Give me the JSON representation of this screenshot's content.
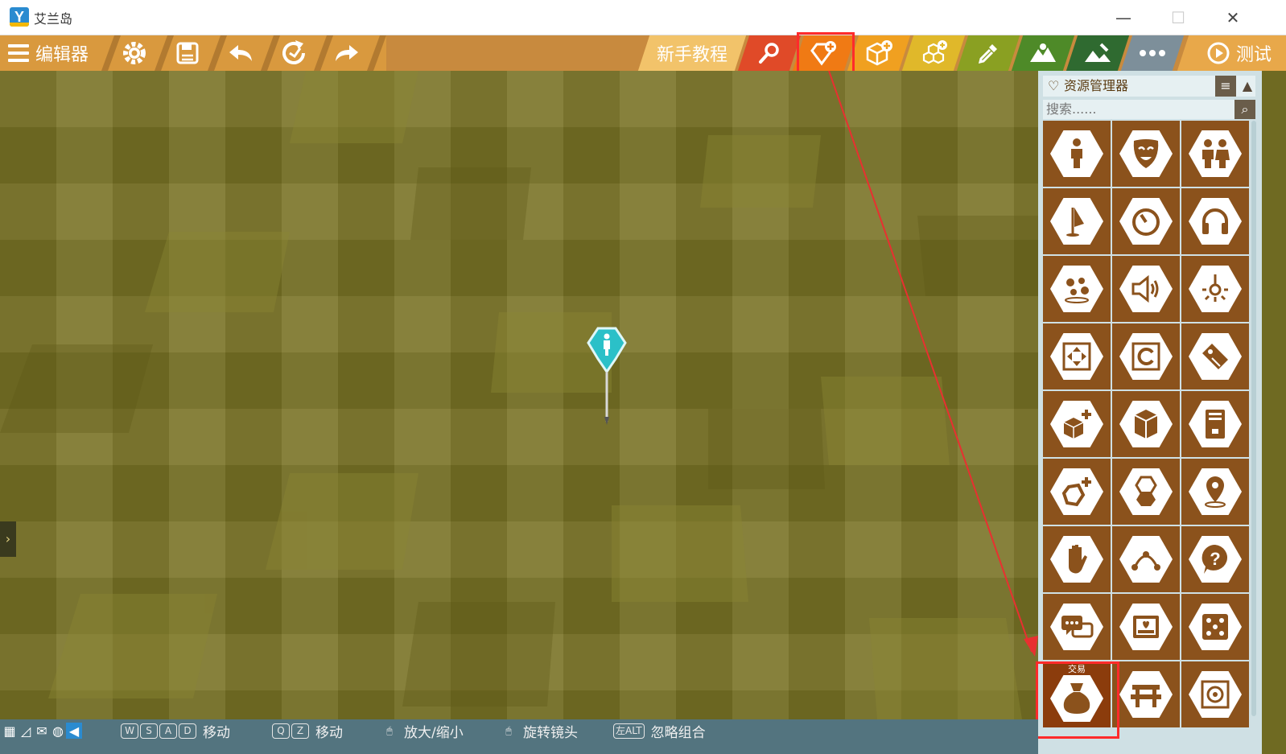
{
  "window": {
    "title": "艾兰岛",
    "logo_letter": "Y",
    "minimize": "—",
    "maximize": "☐",
    "close": "✕"
  },
  "toolbar": {
    "editor_label": "编辑器",
    "tutorial_label": "新手教程",
    "test_label": "测试"
  },
  "panel": {
    "title": "资源管理器",
    "search_placeholder": "搜索......",
    "selected_label": "交易"
  },
  "statusbar": {
    "hints": [
      {
        "keys": [
          "W",
          "S",
          "A",
          "D"
        ],
        "action": "移动"
      },
      {
        "keys": [
          "Q",
          "Z"
        ],
        "action": "移动"
      },
      {
        "keys": [
          "🖱"
        ],
        "action": "放大/缩小"
      },
      {
        "keys": [
          "🖱"
        ],
        "action": "旋转镜头"
      },
      {
        "keys": [
          "左ALT"
        ],
        "action": "忽略组合"
      }
    ]
  },
  "colors": {
    "toolbar": "#c88a3e",
    "tab_highlight": "#ff2b2b",
    "panel_bg": "#cfe0e4",
    "cell_bg": "#8b521c",
    "ground": "#787225",
    "statusbar": "#53747f"
  }
}
